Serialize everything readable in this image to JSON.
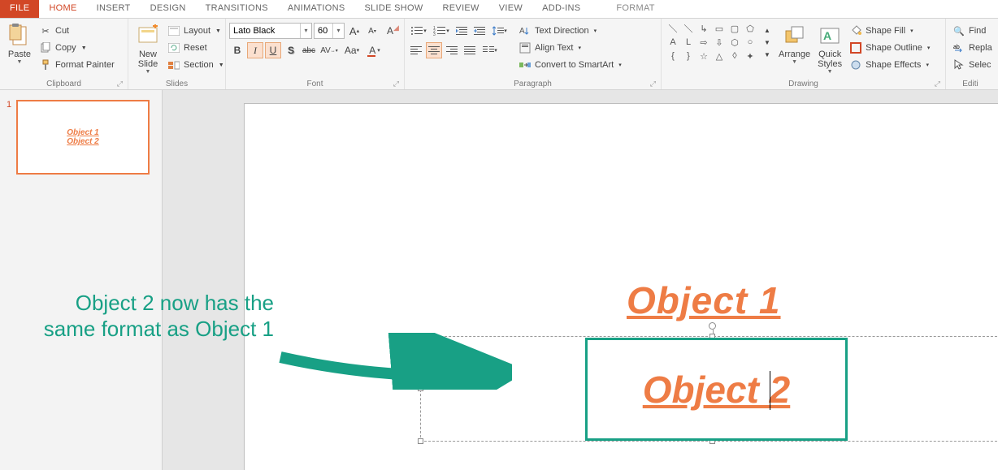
{
  "tabs": {
    "file": "FILE",
    "home": "HOME",
    "insert": "INSERT",
    "design": "DESIGN",
    "transitions": "TRANSITIONS",
    "animations": "ANIMATIONS",
    "slideshow": "SLIDE SHOW",
    "review": "REVIEW",
    "view": "VIEW",
    "addins": "ADD-INS",
    "format": "FORMAT"
  },
  "clipboard": {
    "paste": "Paste",
    "cut": "Cut",
    "copy": "Copy",
    "format_painter": "Format Painter",
    "group": "Clipboard"
  },
  "slides": {
    "new_slide": "New\nSlide",
    "layout": "Layout",
    "reset": "Reset",
    "section": "Section",
    "group": "Slides"
  },
  "font": {
    "name": "Lato Black",
    "size": "60",
    "bold": "B",
    "italic": "I",
    "underline": "U",
    "shadow": "S",
    "strike": "abc",
    "spacing": "AV",
    "case": "Aa",
    "group": "Font"
  },
  "paragraph": {
    "text_direction": "Text Direction",
    "align_text": "Align Text",
    "smartart": "Convert to SmartArt",
    "group": "Paragraph"
  },
  "drawing": {
    "arrange": "Arrange",
    "quick_styles": "Quick\nStyles",
    "shape_fill": "Shape Fill",
    "shape_outline": "Shape Outline",
    "shape_effects": "Shape Effects",
    "group": "Drawing"
  },
  "editing": {
    "find": "Find",
    "replace": "Repla",
    "select": "Selec",
    "group": "Editi"
  },
  "thumbnail": {
    "num": "1",
    "obj1": "Object 1",
    "obj2": "Object 2"
  },
  "slide": {
    "obj1": "Object 1",
    "obj2": "Object 2"
  },
  "annotation": "Object 2 now has the same format as Object 1"
}
